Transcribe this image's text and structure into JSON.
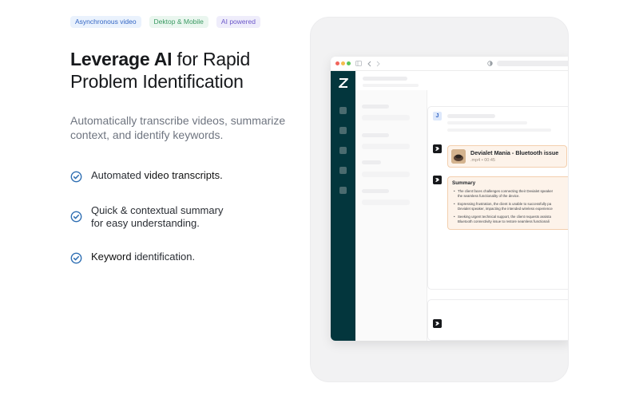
{
  "tags": [
    {
      "label": "Asynchronous video",
      "color": "#3466c4"
    },
    {
      "label": "Dektop & Mobile",
      "color": "#3a9a62"
    },
    {
      "label": "AI powered",
      "color": "#6b57c9"
    }
  ],
  "headline": {
    "bold": "Leverage AI",
    "rest": " for Rapid Problem Identification"
  },
  "subtitle": "Automatically transcribe videos, summarize context, and identify keywords.",
  "features": [
    {
      "pre": "Automated ",
      "bold": "video transcripts.",
      "post": ""
    },
    {
      "pre": "Quick & contextual summary for easy understanding.",
      "bold": "",
      "post": ""
    },
    {
      "pre": "",
      "bold": "Keyword",
      "post": " identification."
    }
  ],
  "mockup": {
    "avatar_letter": "J",
    "video": {
      "title": "Devialet Mania - Bluetooth issue",
      "meta": ".mp4 • 00:45"
    },
    "summary": {
      "heading": "Summary",
      "points": [
        [
          "The client faces challenges connecting their Devialet speaker",
          "the seamless functionality of the device."
        ],
        [
          "Expressing frustration, the client is unable to successfully pa",
          "Devialet speaker, impacting the intended wireless experience"
        ],
        [
          "Seeking urgent technical support, the client requests assista",
          "Bluetooth connectivity issue to restore seamless functionali"
        ]
      ]
    }
  },
  "colors": {
    "sidebar": "#03363d",
    "accent": "#2f6fb3",
    "highlight": "#fdf3ea"
  }
}
